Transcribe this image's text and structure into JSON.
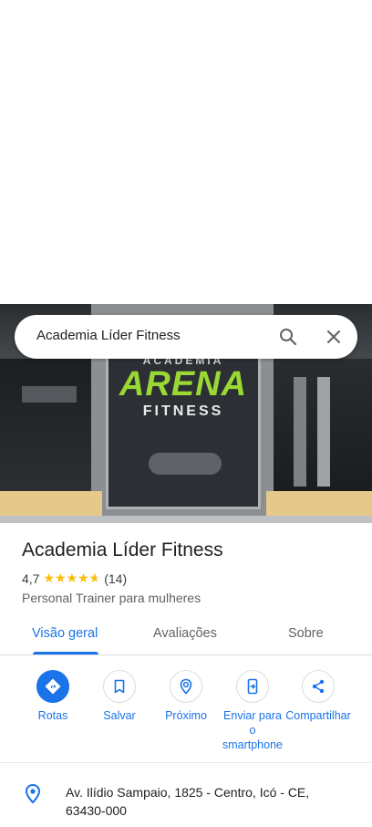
{
  "search": {
    "query": "Academia Líder Fitness"
  },
  "hero": {
    "poster_top": "ACADEMIA",
    "poster_main": "ARENA",
    "poster_sub": "FITNESS"
  },
  "place": {
    "name": "Academia Líder Fitness",
    "rating": "4,7",
    "stars": 4.7,
    "reviews_count": "(14)",
    "category": "Personal Trainer para mulheres"
  },
  "tabs": [
    {
      "label": "Visão geral",
      "active": true
    },
    {
      "label": "Avaliações",
      "active": false
    },
    {
      "label": "Sobre",
      "active": false
    }
  ],
  "actions": [
    {
      "label": "Rotas",
      "icon": "directions-icon"
    },
    {
      "label": "Salvar",
      "icon": "bookmark-icon"
    },
    {
      "label": "Próximo",
      "icon": "nearby-icon"
    },
    {
      "label": "Enviar para o smartphone",
      "icon": "send-to-phone-icon"
    },
    {
      "label": "Compartilhar",
      "icon": "share-icon"
    }
  ],
  "address": {
    "text": "Av. Ilídio Sampaio, 1825 - Centro, Icó - CE, 63430-000",
    "icon": "location-pin-icon"
  },
  "colors": {
    "accent": "#1a73e8",
    "star": "#fbbc04",
    "poster_green": "#9ad933"
  }
}
